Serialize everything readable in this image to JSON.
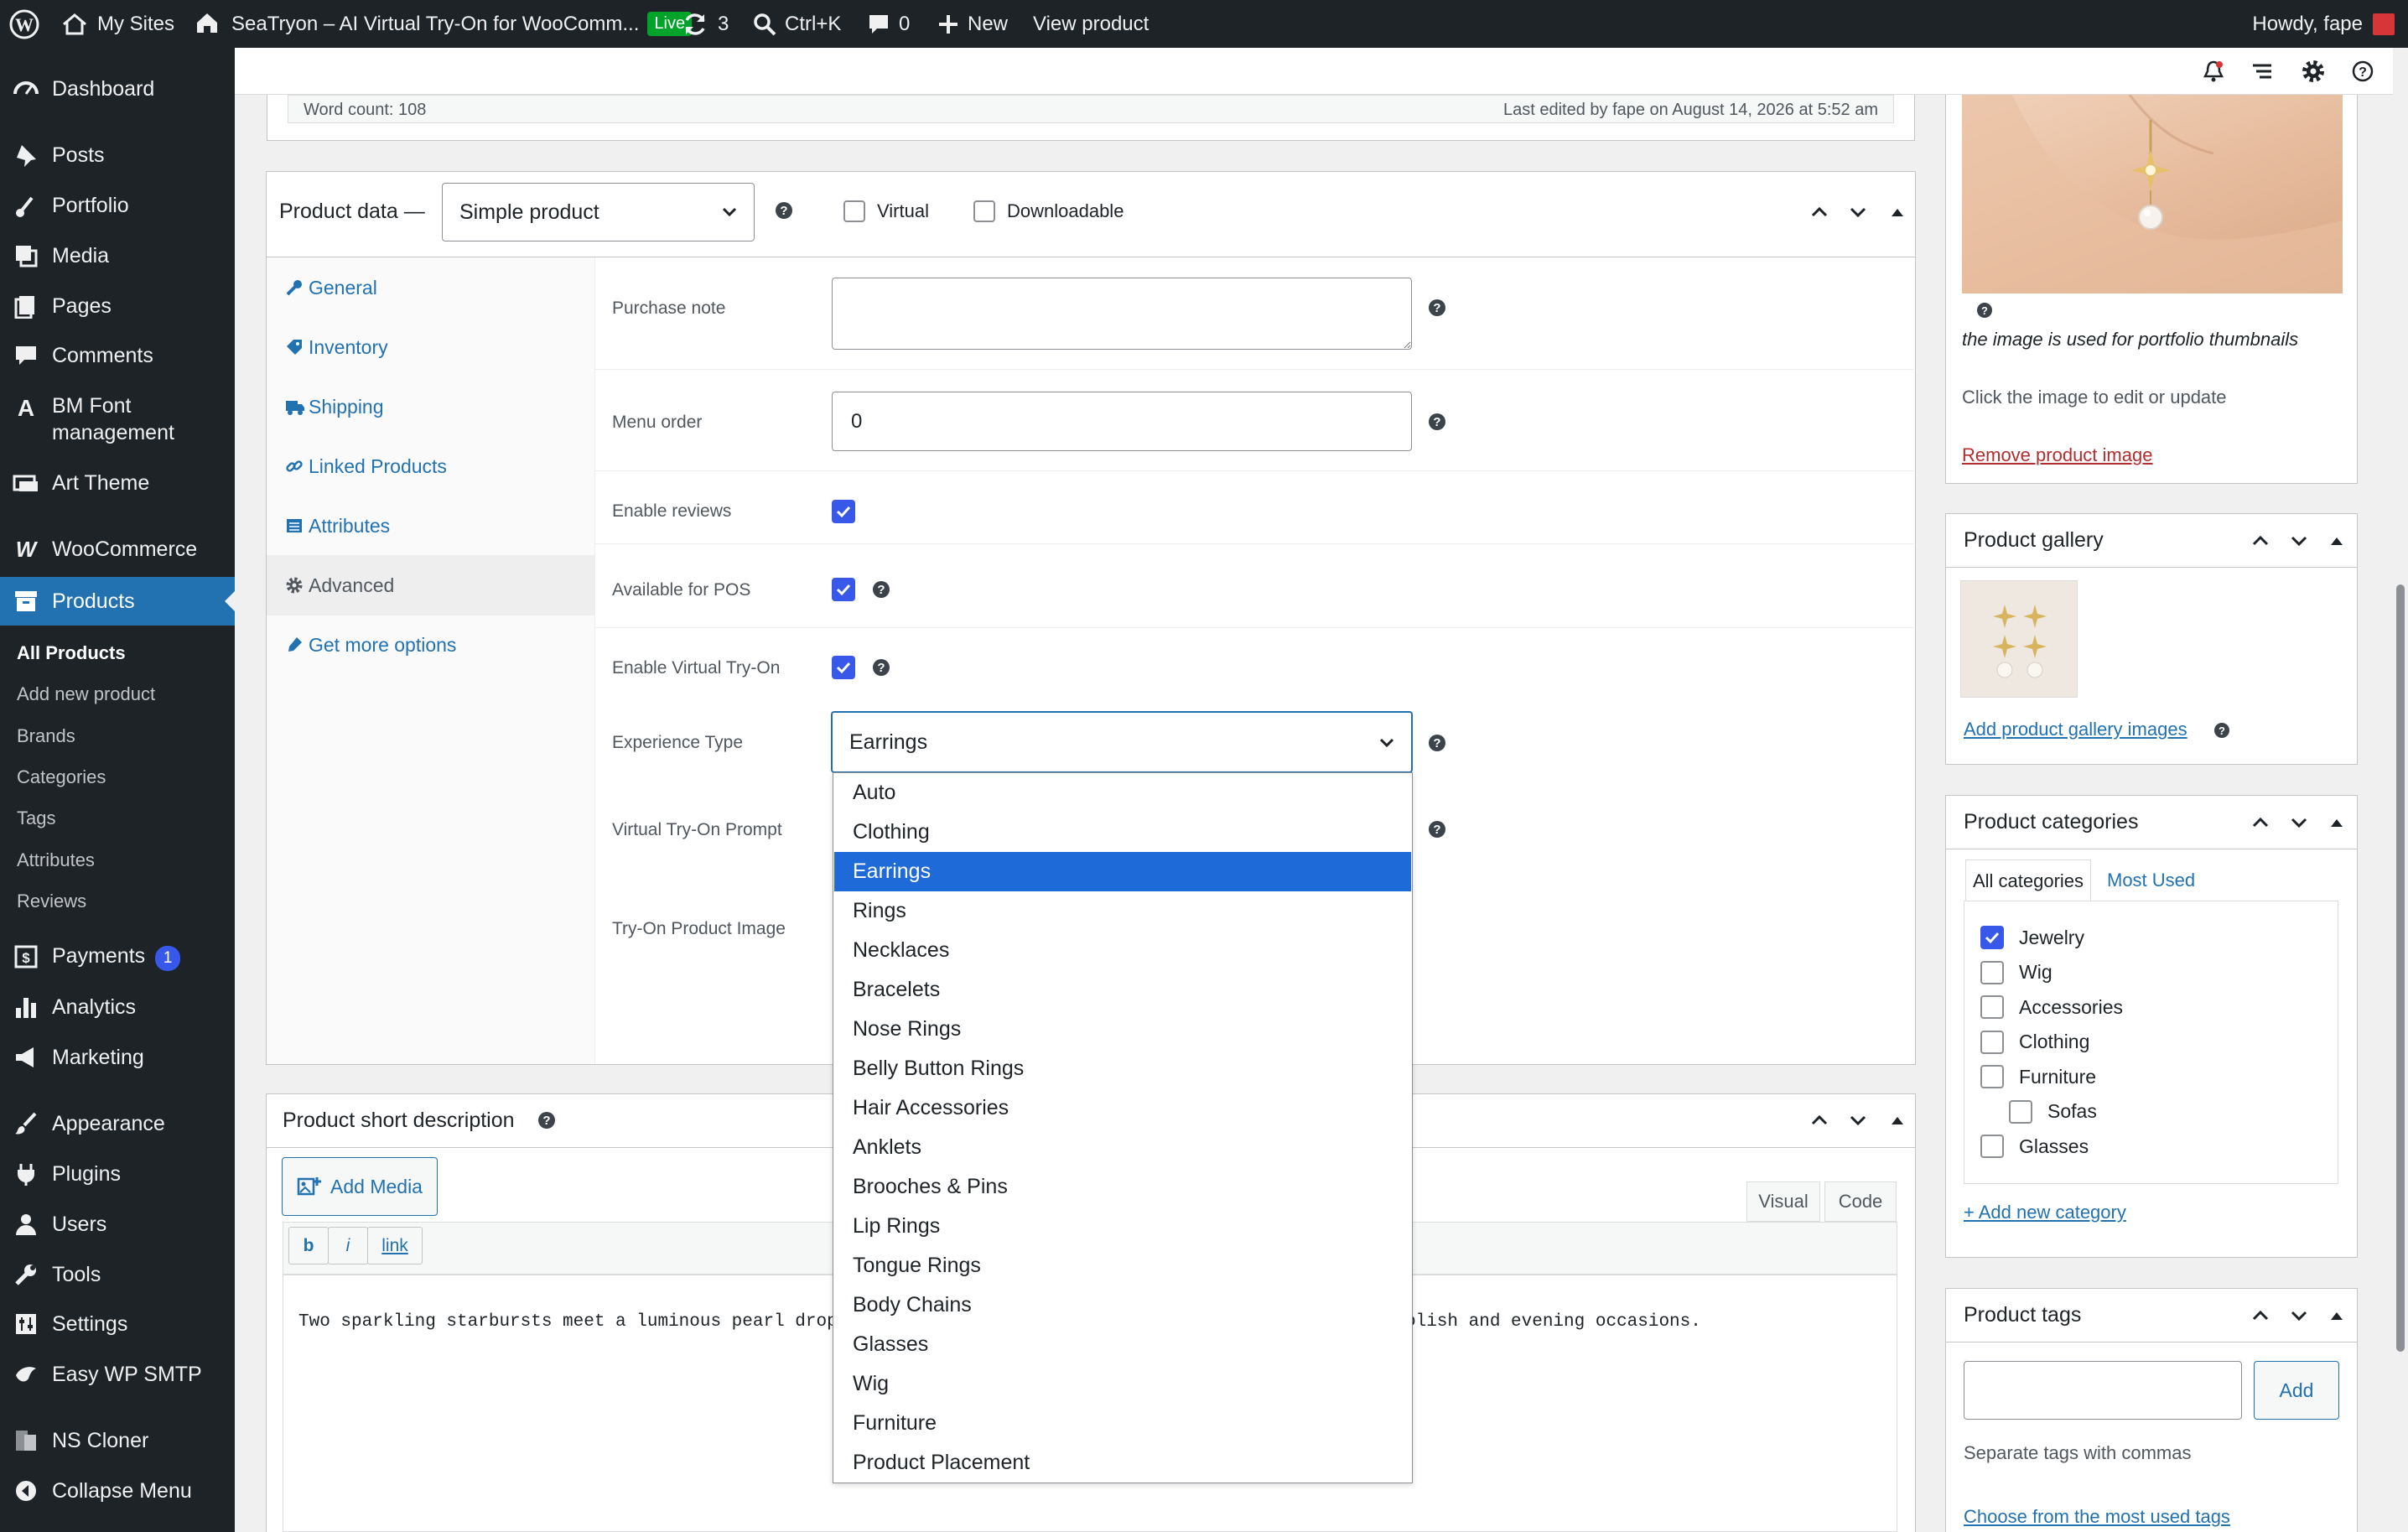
{
  "adminbar": {
    "my_sites": "My Sites",
    "site_name": "SeaTryon – AI Virtual Try-On for WooComm...",
    "live_badge": "Live",
    "updates_count": "3",
    "search_shortcut": "Ctrl+K",
    "comments_count": "0",
    "new_label": "New",
    "view_product": "View product",
    "howdy": "Howdy, fape"
  },
  "sidebar": {
    "dashboard": "Dashboard",
    "posts": "Posts",
    "portfolio": "Portfolio",
    "media": "Media",
    "pages": "Pages",
    "comments": "Comments",
    "bm_font_1": "BM Font",
    "bm_font_2": "management",
    "art_theme": "Art Theme",
    "woocommerce": "WooCommerce",
    "products": "Products",
    "sub": [
      "All Products",
      "Add new product",
      "Brands",
      "Categories",
      "Tags",
      "Attributes",
      "Reviews"
    ],
    "payments": "Payments",
    "payments_badge": "1",
    "analytics": "Analytics",
    "marketing": "Marketing",
    "appearance": "Appearance",
    "plugins": "Plugins",
    "users": "Users",
    "tools": "Tools",
    "settings": "Settings",
    "easy_wp_smtp": "Easy WP SMTP",
    "ns_cloner": "NS Cloner",
    "collapse": "Collapse Menu"
  },
  "editor_status": {
    "word_count": "Word count: 108",
    "last_edited": "Last edited by fape on August 14, 2026 at 5:52 am"
  },
  "product_data": {
    "title": "Product data —",
    "type_value": "Simple product",
    "virtual_label": "Virtual",
    "downloadable_label": "Downloadable",
    "tabs": [
      "General",
      "Inventory",
      "Shipping",
      "Linked Products",
      "Attributes",
      "Advanced",
      "Get more options"
    ],
    "purchase_note_label": "Purchase note",
    "purchase_note_value": "",
    "menu_order_label": "Menu order",
    "menu_order_value": "0",
    "enable_reviews_label": "Enable reviews",
    "available_pos_label": "Available for POS",
    "enable_tryon_label": "Enable Virtual Try-On",
    "experience_type_label": "Experience Type",
    "experience_type_value": "Earrings",
    "tryon_prompt_label": "Virtual Try-On Prompt",
    "tryon_image_label": "Try-On Product Image",
    "experience_options": [
      "Auto",
      "Clothing",
      "Earrings",
      "Rings",
      "Necklaces",
      "Bracelets",
      "Nose Rings",
      "Belly Button Rings",
      "Hair Accessories",
      "Anklets",
      "Brooches & Pins",
      "Lip Rings",
      "Tongue Rings",
      "Body Chains",
      "Glasses",
      "Wig",
      "Furniture",
      "Product Placement"
    ],
    "selected_option": "Earrings"
  },
  "short_description": {
    "title": "Product short description",
    "add_media": "Add Media",
    "visual_tab": "Visual",
    "code_tab": "Code",
    "fmt_b": "b",
    "fmt_i": "i",
    "fmt_link": "link",
    "content_start": "Two sparkling starbursts meet a luminous pearl drop",
    "content_end": "olish and evening occasions."
  },
  "product_image": {
    "note": "the image is used for portfolio thumbnails",
    "click_hint": "Click the image to edit or update",
    "remove_link": "Remove product image"
  },
  "product_gallery": {
    "title": "Product gallery",
    "add_link": "Add product gallery images"
  },
  "product_categories": {
    "title": "Product categories",
    "tab_all": "All categories",
    "tab_most_used": "Most Used",
    "items": [
      {
        "name": "Jewelry",
        "checked": true,
        "child": false
      },
      {
        "name": "Wig",
        "checked": false,
        "child": false
      },
      {
        "name": "Accessories",
        "checked": false,
        "child": false
      },
      {
        "name": "Clothing",
        "checked": false,
        "child": false
      },
      {
        "name": "Furniture",
        "checked": false,
        "child": false
      },
      {
        "name": "Sofas",
        "checked": false,
        "child": true
      },
      {
        "name": "Glasses",
        "checked": false,
        "child": false
      }
    ],
    "add_new": "+ Add new category"
  },
  "product_tags": {
    "title": "Product tags",
    "input_value": "",
    "add_button": "Add",
    "hint": "Separate tags with commas",
    "choose_link": "Choose from the most used tags"
  },
  "colors": {
    "accent": "#2271b1",
    "admin_dark": "#1d2327",
    "checkbox_blue": "#3858e9",
    "option_highlight": "#1e6ad9",
    "live_green": "#00a32a"
  },
  "icons": [
    "wordpress-logo-icon",
    "home-icon",
    "refresh-icon",
    "search-icon",
    "comment-icon",
    "plus-icon",
    "help-icon",
    "gear-icon",
    "chevron-up-icon",
    "chevron-down-icon",
    "triangle-icon"
  ]
}
